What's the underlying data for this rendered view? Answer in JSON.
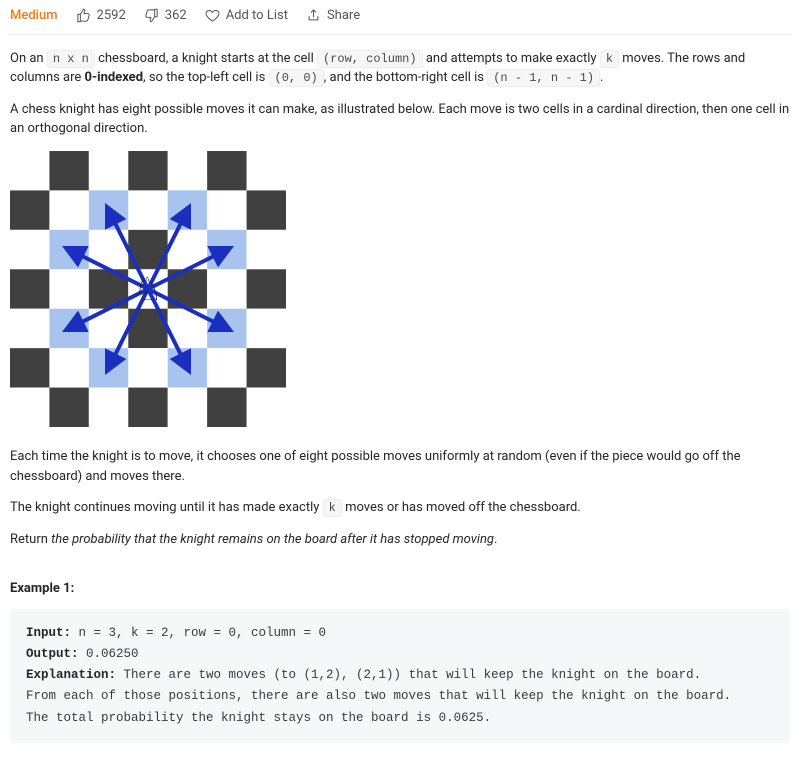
{
  "topbar": {
    "difficulty": "Medium",
    "upvotes": "2592",
    "downvotes": "362",
    "add_to_list": "Add to List",
    "share": "Share"
  },
  "para1": {
    "t1": "On an ",
    "c1": "n x n",
    "t2": " chessboard, a knight starts at the cell ",
    "c2": "(row, column)",
    "t3": " and attempts to make exactly ",
    "c3": "k",
    "t4": " moves. The rows and columns are ",
    "b1": "0-indexed",
    "t5": ", so the top-left cell is ",
    "c4": "(0, 0)",
    "t6": ", and the bottom-right cell is ",
    "c5": "(n - 1, n - 1)",
    "t7": "."
  },
  "para2": "A chess knight has eight possible moves it can make, as illustrated below. Each move is two cells in a cardinal direction, then one cell in an orthogonal direction.",
  "para3": "Each time the knight is to move, it chooses one of eight possible moves uniformly at random (even if the piece would go off the chessboard) and moves there.",
  "para4": {
    "t1": "The knight continues moving until it has made exactly ",
    "c1": "k",
    "t2": " moves or has moved off the chessboard."
  },
  "para5": {
    "t1": "Return ",
    "e1": "the probability that the knight remains on the board after it has stopped moving",
    "t2": "."
  },
  "example1": {
    "heading": "Example 1:",
    "input_lbl": "Input:",
    "input_val": " n = 3, k = 2, row = 0, column = 0",
    "output_lbl": "Output:",
    "output_val": " 0.06250",
    "expl_lbl": "Explanation:",
    "expl_l1": " There are two moves (to (1,2), (2,1)) that will keep the knight on the board.",
    "expl_l2": "From each of those positions, there are also two moves that will keep the knight on the board.",
    "expl_l3": "The total probability the knight stays on the board is 0.0625."
  },
  "diagram": {
    "board_n": 7,
    "dark": "#404040",
    "light": "#ffffff",
    "highlight": "#a8c3ee",
    "arrow": "#1a2fbf",
    "knight_moves": [
      [
        1,
        2
      ],
      [
        2,
        1
      ],
      [
        1,
        4
      ],
      [
        2,
        5
      ],
      [
        4,
        1
      ],
      [
        5,
        2
      ],
      [
        4,
        5
      ],
      [
        5,
        4
      ]
    ]
  }
}
